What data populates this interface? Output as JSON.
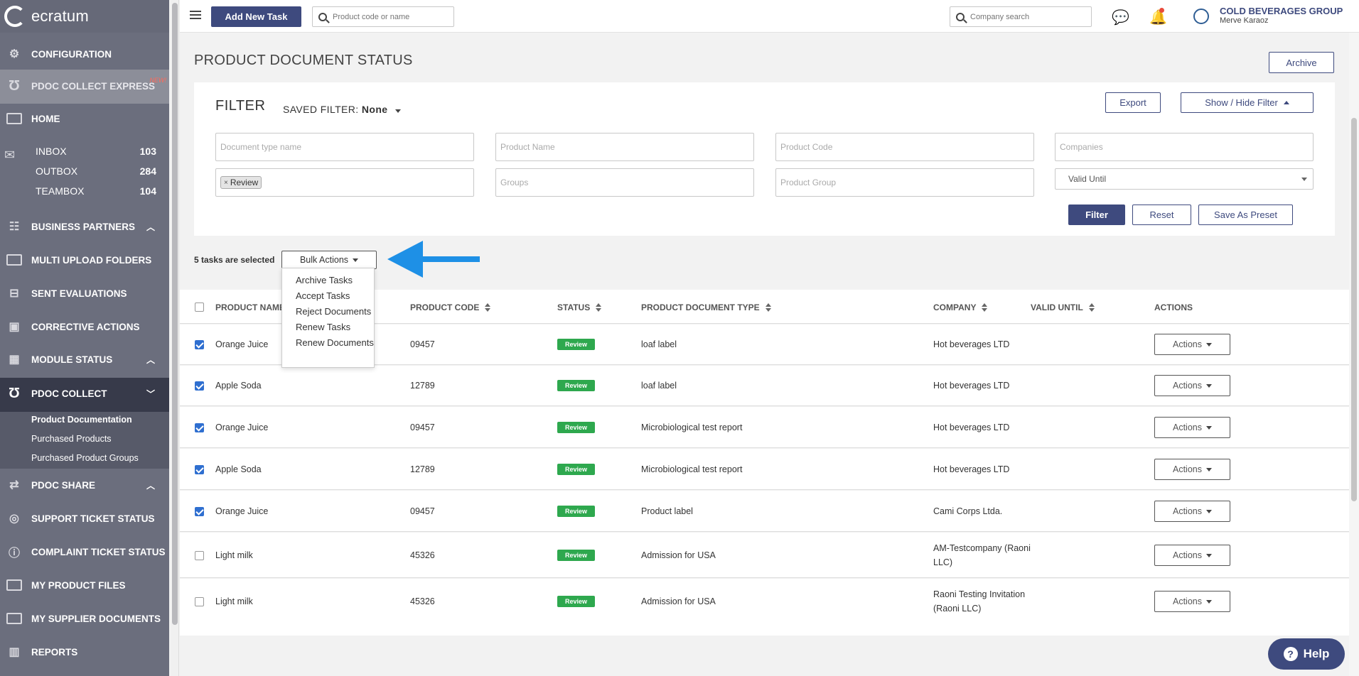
{
  "brand": {
    "name": "ecratum"
  },
  "sidebar": {
    "items": [
      {
        "label": "CONFIGURATION"
      },
      {
        "label": "PDOC COLLECT EXPRESS",
        "badge": "NEW!"
      },
      {
        "label": "HOME"
      },
      {
        "label": "BUSINESS PARTNERS"
      },
      {
        "label": "MULTI UPLOAD FOLDERS"
      },
      {
        "label": "SENT EVALUATIONS"
      },
      {
        "label": "CORRECTIVE ACTIONS"
      },
      {
        "label": "MODULE STATUS"
      },
      {
        "label": "PDOC COLLECT"
      },
      {
        "label": "PDOC SHARE"
      },
      {
        "label": "SUPPORT TICKET STATUS"
      },
      {
        "label": "COMPLAINT TICKET STATUS"
      },
      {
        "label": "MY PRODUCT FILES"
      },
      {
        "label": "MY SUPPLIER DOCUMENTS"
      },
      {
        "label": "REPORTS"
      }
    ],
    "mailboxes": [
      {
        "label": "INBOX",
        "count": "103"
      },
      {
        "label": "OUTBOX",
        "count": "284"
      },
      {
        "label": "TEAMBOX",
        "count": "104"
      }
    ],
    "pdoc_collect_children": [
      {
        "label": "Product Documentation"
      },
      {
        "label": "Purchased Products"
      },
      {
        "label": "Purchased Product Groups"
      }
    ]
  },
  "topbar": {
    "add_task_label": "Add New Task",
    "product_search_placeholder": "Product code or name",
    "company_search_placeholder": "Company search",
    "company_name": "COLD BEVERAGES GROUP",
    "user_name": "Merve Karaoz"
  },
  "page": {
    "title": "PRODUCT DOCUMENT STATUS",
    "archive_label": "Archive"
  },
  "filter": {
    "title": "FILTER",
    "saved_filter_label": "SAVED FILTER:",
    "saved_filter_value": "None",
    "export_label": "Export",
    "show_hide_label": "Show / Hide Filter",
    "placeholders": {
      "document_type": "Document type name",
      "product_name": "Product Name",
      "product_code": "Product Code",
      "companies": "Companies",
      "groups": "Groups",
      "product_group": "Product Group"
    },
    "status_tag": "Review",
    "valid_until": "Valid Until",
    "filter_btn": "Filter",
    "reset_btn": "Reset",
    "save_preset_btn": "Save As Preset"
  },
  "bulk": {
    "selected_text": "5 tasks are selected",
    "button_label": "Bulk Actions",
    "menu": [
      "Archive Tasks",
      "Accept Tasks",
      "Reject Documents",
      "Renew Tasks",
      "Renew Documents"
    ]
  },
  "table": {
    "headers": {
      "product_name": "PRODUCT NAME",
      "product_code": "PRODUCT CODE",
      "status": "STATUS",
      "doc_type": "PRODUCT DOCUMENT TYPE",
      "company": "COMPANY",
      "valid_until": "VALID UNTIL",
      "actions": "ACTIONS"
    },
    "action_label": "Actions",
    "rows": [
      {
        "checked": true,
        "name": "Orange Juice",
        "code": "09457",
        "status": "Review",
        "doc_type": "loaf label",
        "company": "Hot beverages LTD"
      },
      {
        "checked": true,
        "name": "Apple Soda",
        "code": "12789",
        "status": "Review",
        "doc_type": "loaf label",
        "company": "Hot beverages LTD"
      },
      {
        "checked": true,
        "name": "Orange Juice",
        "code": "09457",
        "status": "Review",
        "doc_type": "Microbiological test report",
        "company": "Hot beverages LTD"
      },
      {
        "checked": true,
        "name": "Apple Soda",
        "code": "12789",
        "status": "Review",
        "doc_type": "Microbiological test report",
        "company": "Hot beverages LTD"
      },
      {
        "checked": true,
        "name": "Orange Juice",
        "code": "09457",
        "status": "Review",
        "doc_type": "Product label",
        "company": "Cami Corps Ltda."
      },
      {
        "checked": false,
        "name": "Light milk",
        "code": "45326",
        "status": "Review",
        "doc_type": "Admission for USA",
        "company_line1": "AM-Testcompany (Raoni",
        "company_line2": "LLC)"
      },
      {
        "checked": false,
        "name": "Light milk",
        "code": "45326",
        "status": "Review",
        "doc_type": "Admission for USA",
        "company_line1": "Raoni Testing Invitation",
        "company_line2": "(Raoni LLC)"
      }
    ]
  },
  "help": {
    "label": "Help"
  },
  "colors": {
    "primary": "#3e4a7e",
    "sidebar": "#6b6e7d",
    "status_review": "#2ea84e",
    "arrow": "#1e90e6"
  }
}
